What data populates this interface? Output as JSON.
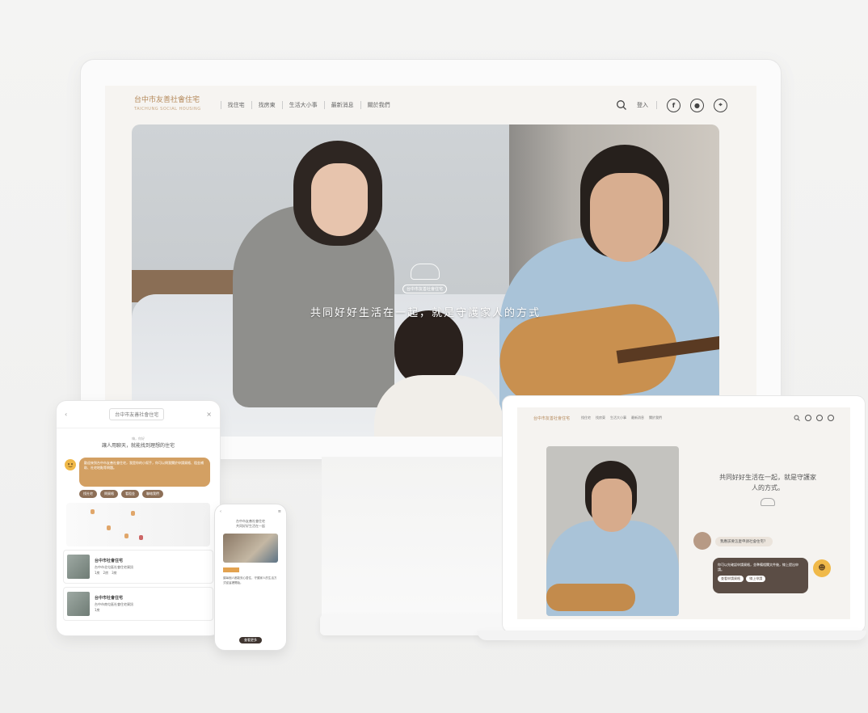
{
  "monitor": {
    "logo_title": "台中市友善社會住宅",
    "logo_sub": "TAICHUNG SOCIAL HOUSING",
    "nav": [
      "找住宅",
      "找房東",
      "生活大小事",
      "最新消息",
      "關於我們"
    ],
    "login": "登入",
    "social_icons": [
      "facebook-icon",
      "line-icon",
      "location-pin-icon"
    ],
    "hero_caption": "共同好好生活在一起，就是守護家人的方式",
    "hero_badge": "台中市友善社會住宅"
  },
  "tablet": {
    "logo": "台中市友善社會住宅",
    "title_small": "嗨，你好",
    "title": "讓人用聊天，就能找到理想的住宅",
    "bubble": "歡迎來到台中市友善社會住宅，我是你的小幫手，你可以問我關於申請資格、租金補助、社宅地點等問題。",
    "chips": [
      "找社宅",
      "問資格",
      "看租金",
      "聯絡我們"
    ],
    "cards": [
      {
        "title": "台中市社會住宅",
        "desc": "台中市北屯區社會住宅資訊",
        "meta": "1房　2房　3房"
      },
      {
        "title": "台中市社會住宅",
        "desc": "台中市南屯區社會住宅資訊",
        "meta": "1房"
      }
    ]
  },
  "phone": {
    "header_left": "‹",
    "header_right": "≡",
    "title_small": "台中市友善社會住宅",
    "title": "共同好好生活在一起",
    "text": "讓每個人都能安心居住，守護家人的生活方式從這裡開始。",
    "button": "查看更多"
  },
  "laptop": {
    "logo": "台中市友善社會住宅",
    "nav": [
      "找住宅",
      "找房東",
      "生活大小事",
      "最新消息",
      "關於我們"
    ],
    "quote": "共同好好生活在一起，就是守護家人的方式。",
    "user_question": "我應該要怎麼申請社會住宅？",
    "bot_answer": "你可以先確認申請資格，並準備相關文件後，線上提出申請。",
    "answer_buttons": [
      "查看申請資格",
      "線上申請"
    ]
  }
}
